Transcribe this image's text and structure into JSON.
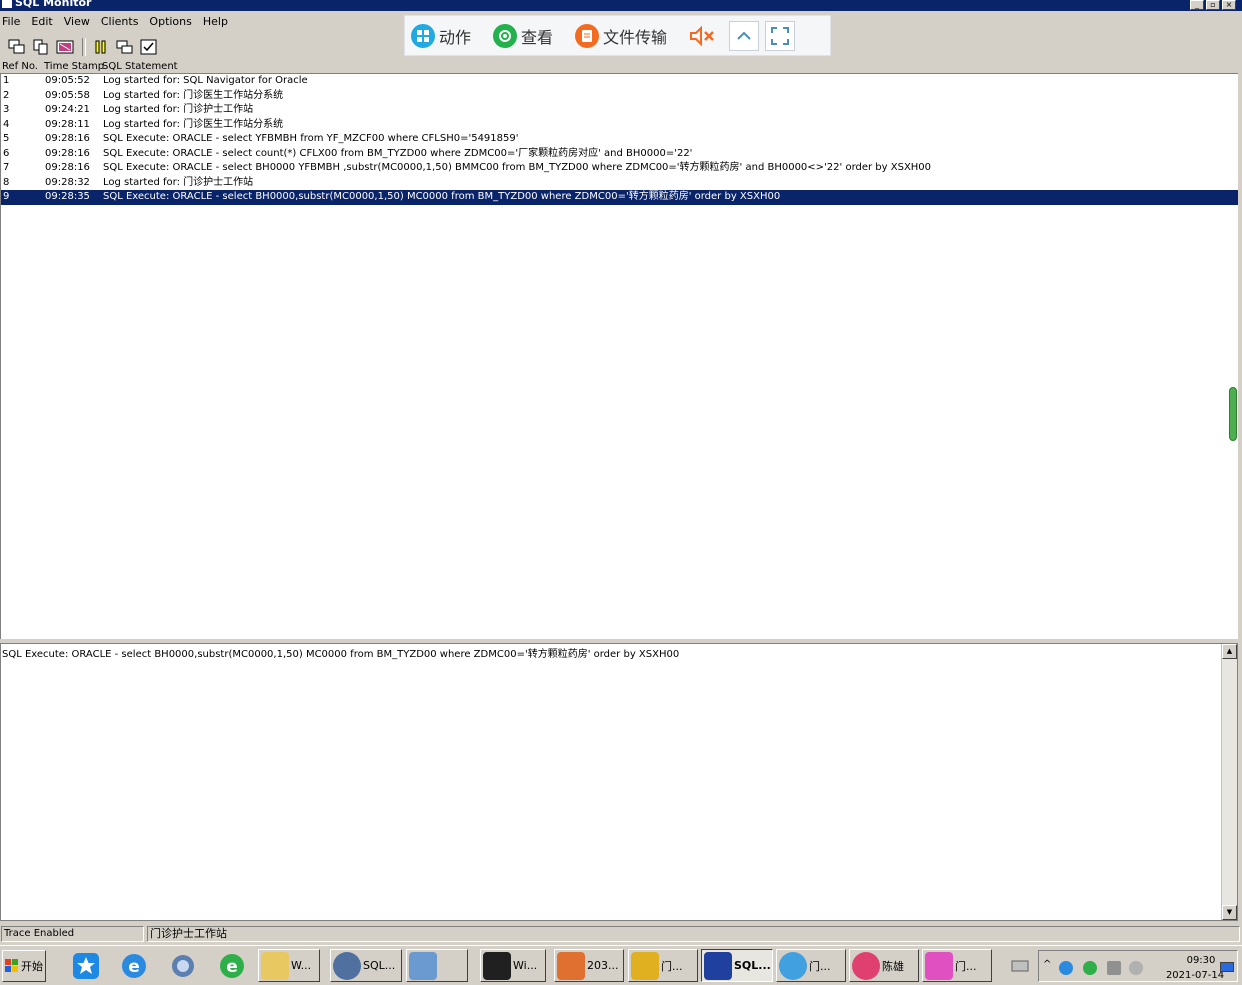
{
  "window": {
    "title": "SQL Monitor",
    "controls": [
      "_",
      "▫",
      "×"
    ]
  },
  "menu": [
    {
      "label": "File"
    },
    {
      "label": "Edit"
    },
    {
      "label": "View"
    },
    {
      "label": "Clients"
    },
    {
      "label": "Options"
    },
    {
      "label": "Help"
    }
  ],
  "toolbar": {
    "icons": [
      "copy-window-icon",
      "copy-icon",
      "clear-log-icon",
      "pause-icon",
      "windows-icon",
      "checklist-icon"
    ]
  },
  "remote_bar": {
    "action_label": "动作",
    "view_label": "查看",
    "transfer_label": "文件传输",
    "colors": {
      "action": "#21a9e1",
      "view": "#22b14c",
      "transfer": "#f36b21",
      "mute": "#f36b21"
    }
  },
  "log": {
    "columns": [
      "Ref No.",
      "Time Stamp",
      "SQL Statement"
    ],
    "rows": [
      {
        "ref": "1",
        "time": "09:05:52",
        "statement": "Log started for: SQL Navigator for Oracle"
      },
      {
        "ref": "2",
        "time": "09:05:58",
        "statement": "Log started for: 门诊医生工作站分系统"
      },
      {
        "ref": "3",
        "time": "09:24:21",
        "statement": "Log started for: 门诊护士工作站"
      },
      {
        "ref": "4",
        "time": "09:28:11",
        "statement": "Log started for: 门诊医生工作站分系统"
      },
      {
        "ref": "5",
        "time": "09:28:16",
        "statement": "SQL Execute: ORACLE - select YFBMBH from YF_MZCF00 where CFLSH0='5491859'"
      },
      {
        "ref": "6",
        "time": "09:28:16",
        "statement": "SQL Execute: ORACLE - select count(*) CFLX00 from BM_TYZD00 where ZDMC00='厂家颗粒药房对应' and BH0000='22'"
      },
      {
        "ref": "7",
        "time": "09:28:16",
        "statement": "SQL Execute: ORACLE - select BH0000 YFBMBH ,substr(MC0000,1,50) BMMC00 from BM_TYZD00 where ZDMC00='转方颗粒药房' and BH0000<>'22' order by XSXH00"
      },
      {
        "ref": "8",
        "time": "09:28:32",
        "statement": "Log started for: 门诊护士工作站"
      },
      {
        "ref": "9",
        "time": "09:28:35",
        "statement": "SQL Execute: ORACLE - select BH0000,substr(MC0000,1,50) MC0000 from BM_TYZD00 where ZDMC00='转方颗粒药房' order by XSXH00",
        "selected": true
      }
    ]
  },
  "detail": {
    "text": "SQL Execute: ORACLE - select BH0000,substr(MC0000,1,50) MC0000 from BM_TYZD00 where ZDMC00='转方颗粒药房' order by XSXH00"
  },
  "status": {
    "trace": "Trace Enabled",
    "client": "门诊护士工作站"
  },
  "taskbar": {
    "start_label": "开始",
    "tasks": [
      {
        "label": "W...",
        "icon_color": "#e8c860"
      },
      {
        "label": "SQL...",
        "icon_color": "#5070a0"
      },
      {
        "label": "",
        "icon_color": "#6a9ad0"
      },
      {
        "label": "Wi...",
        "icon_color": "#202020"
      },
      {
        "label": "203...",
        "icon_color": "#e07030"
      },
      {
        "label": "门...",
        "icon_color": "#e0b020"
      },
      {
        "label": "SQL...",
        "icon_color": "#2040a0",
        "active": true
      },
      {
        "label": "门...",
        "icon_color": "#40a0e0"
      },
      {
        "label": "陈雄",
        "icon_color": "#e04070"
      },
      {
        "label": "门...",
        "icon_color": "#e050c0"
      }
    ],
    "clock_time": "09:30",
    "clock_date": "2021-07-14"
  }
}
